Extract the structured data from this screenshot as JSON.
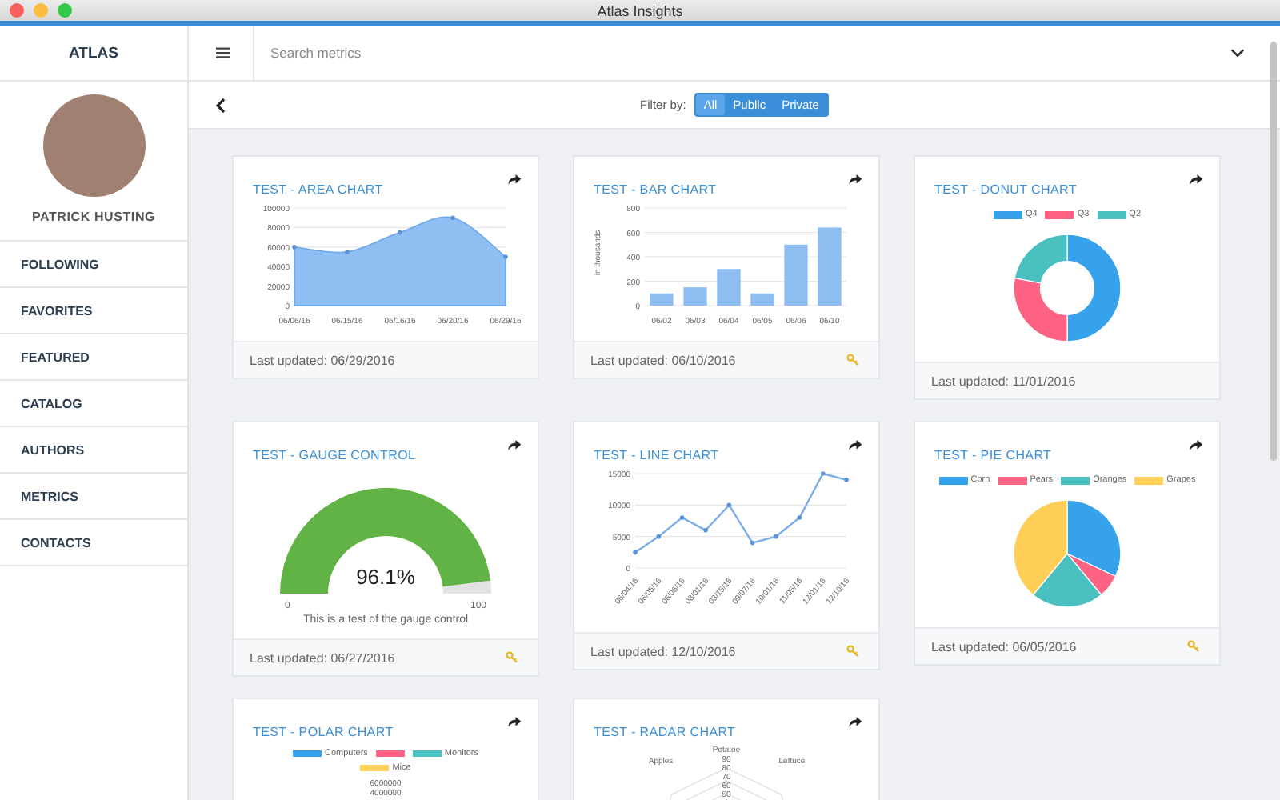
{
  "window": {
    "title": "Atlas Insights"
  },
  "sidebar": {
    "brand": "ATLAS",
    "user_name": "PATRICK HUSTING",
    "items": [
      {
        "label": "FOLLOWING",
        "selected": false
      },
      {
        "label": "FAVORITES",
        "selected": false
      },
      {
        "label": "FEATURED",
        "selected": false
      },
      {
        "label": "CATALOG",
        "selected": false
      },
      {
        "label": "AUTHORS",
        "selected": false
      },
      {
        "label": "METRICS",
        "selected": false
      },
      {
        "label": "CONTACTS",
        "selected": false
      }
    ]
  },
  "topbar": {
    "search": {
      "placeholder": "Search metrics"
    }
  },
  "filter": {
    "label": "Filter by:",
    "options": [
      {
        "label": "All",
        "selected": true
      },
      {
        "label": "Public",
        "selected": false
      },
      {
        "label": "Private",
        "selected": false
      }
    ]
  },
  "cards": [
    {
      "title": "TEST - AREA CHART",
      "kind": "chart",
      "chart_data": {
        "type": "area",
        "categories": [
          "06/06/16",
          "06/15/16",
          "06/16/16",
          "06/20/16",
          "06/29/16"
        ],
        "series": [
          {
            "color": "#8fbff2",
            "values": [
              60000,
              55000,
              75000,
              90000,
              50000
            ]
          }
        ],
        "yticks": [
          0,
          20000,
          40000,
          60000,
          80000,
          100000
        ],
        "ylim": [
          0,
          100000
        ],
        "grid": true
      },
      "last_updated": "Last updated: 06/29/2016",
      "key": false
    },
    {
      "title": "TEST - BAR CHART",
      "kind": "chart",
      "chart_data": {
        "type": "bar",
        "ylabel": "in thousands",
        "categories": [
          "06/02",
          "06/03",
          "06/04",
          "06/05",
          "06/06",
          "06/10"
        ],
        "series": [
          {
            "color": "#8fbff2",
            "values": [
              100,
              150,
              300,
              100,
              500,
              640
            ]
          }
        ],
        "yticks": [
          0,
          200,
          400,
          600,
          800
        ],
        "ylim": [
          0,
          800
        ],
        "grid": true
      },
      "last_updated": "Last updated: 06/10/2016",
      "key": true
    },
    {
      "title": "TEST - DONUT CHART",
      "kind": "chart",
      "chart_data": {
        "type": "donut",
        "categories": [
          "Q4",
          "Q3",
          "Q2"
        ],
        "series": [
          {
            "values": [
              50,
              28,
              22
            ]
          }
        ],
        "colors": [
          "#36a2eb",
          "#ff6384",
          "#4bc0c0"
        ],
        "legend": true
      },
      "last_updated": "Last updated: 11/01/2016",
      "key": false
    },
    {
      "title": "TEST - GAUGE CONTROL",
      "kind": "gauge",
      "gauge": {
        "level": 0.961,
        "value": "96.1%",
        "min": "0",
        "max": "100",
        "caption": "This is a test of the gauge control"
      },
      "last_updated": "Last updated: 06/27/2016",
      "key": true
    },
    {
      "title": "TEST - LINE CHART",
      "kind": "chart",
      "chart_data": {
        "type": "line",
        "categories": [
          "06/04/16",
          "06/05/16",
          "06/06/16",
          "08/01/16",
          "08/15/16",
          "09/07/16",
          "10/01/16",
          "11/05/16",
          "12/01/16",
          "12/10/16"
        ],
        "series": [
          {
            "color": "#7aaee8",
            "values": [
              2500,
              5000,
              8000,
              6000,
              10000,
              4000,
              5000,
              8000,
              15000,
              14000
            ]
          }
        ],
        "yticks": [
          0,
          5000,
          10000,
          15000
        ],
        "ylim": [
          0,
          15000
        ],
        "grid": true
      },
      "last_updated": "Last updated: 12/10/2016",
      "key": true
    },
    {
      "title": "TEST - PIE CHART",
      "kind": "chart",
      "chart_data": {
        "type": "pie",
        "categories": [
          "Corn",
          "Pears",
          "Oranges",
          "Grapes"
        ],
        "series": [
          {
            "values": [
              32,
              7,
              22,
              39
            ]
          }
        ],
        "colors": [
          "#36a2eb",
          "#ff6384",
          "#4bc0c0",
          "#ffce56"
        ],
        "legend": true
      },
      "last_updated": "Last updated: 06/05/2016",
      "key": true
    },
    {
      "title": "TEST - POLAR CHART",
      "kind": "polar",
      "legend": [
        {
          "label": "Computers",
          "color": "#36a2eb"
        },
        {
          "color": "#ff6384"
        },
        {
          "label": "Monitors",
          "color": "#4bc0c0"
        },
        {
          "label": "Mice",
          "color": "#ffce56"
        }
      ],
      "ticks": [
        "6000000",
        "4000000"
      ]
    },
    {
      "title": "TEST - RADAR CHART",
      "kind": "radar",
      "axis_labels": [
        "Potatoe",
        "Apples",
        "Lettuce"
      ],
      "ticks": [
        "90",
        "80",
        "70",
        "60",
        "50"
      ]
    }
  ]
}
